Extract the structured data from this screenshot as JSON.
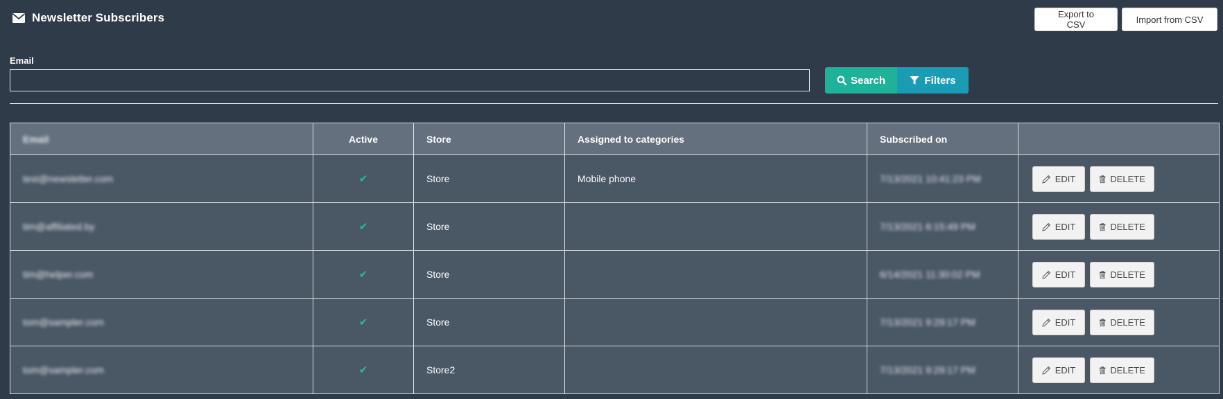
{
  "header": {
    "title": "Newsletter Subscribers",
    "icon": "envelope-icon"
  },
  "toolbar": {
    "export_label": "Export to CSV",
    "import_label": "Import from CSV"
  },
  "filters": {
    "email_label": "Email",
    "email_value": "",
    "search_label": "Search",
    "filters_label": "Filters"
  },
  "colors": {
    "background": "#2f3b49",
    "search": "#1fb29a",
    "filters": "#1a9cb5",
    "header_row": "#64707e",
    "row": "#4a5765",
    "check": "#1fc09f"
  },
  "table": {
    "headers": [
      "Email",
      "Active",
      "Store",
      "Assigned to categories",
      "Subscribed on",
      ""
    ],
    "edit_label": "EDIT",
    "delete_label": "DELETE",
    "rows": [
      {
        "email": "test@newsletter.com",
        "active": "✔",
        "store": "Store",
        "categories": "Mobile phone",
        "subscribed_on": "7/13/2021 10:41:23 PM"
      },
      {
        "email": "tim@affiliated.by",
        "active": "✔",
        "store": "Store",
        "categories": "",
        "subscribed_on": "7/13/2021 6:15:49 PM"
      },
      {
        "email": "tim@helper.com",
        "active": "✔",
        "store": "Store",
        "categories": "",
        "subscribed_on": "6/14/2021 11:30:02 PM"
      },
      {
        "email": "tom@sampler.com",
        "active": "✔",
        "store": "Store",
        "categories": "",
        "subscribed_on": "7/13/2021 9:29:17 PM"
      },
      {
        "email": "tom@sampler.com",
        "active": "✔",
        "store": "Store2",
        "categories": "",
        "subscribed_on": "7/13/2021 9:29:17 PM"
      }
    ]
  }
}
